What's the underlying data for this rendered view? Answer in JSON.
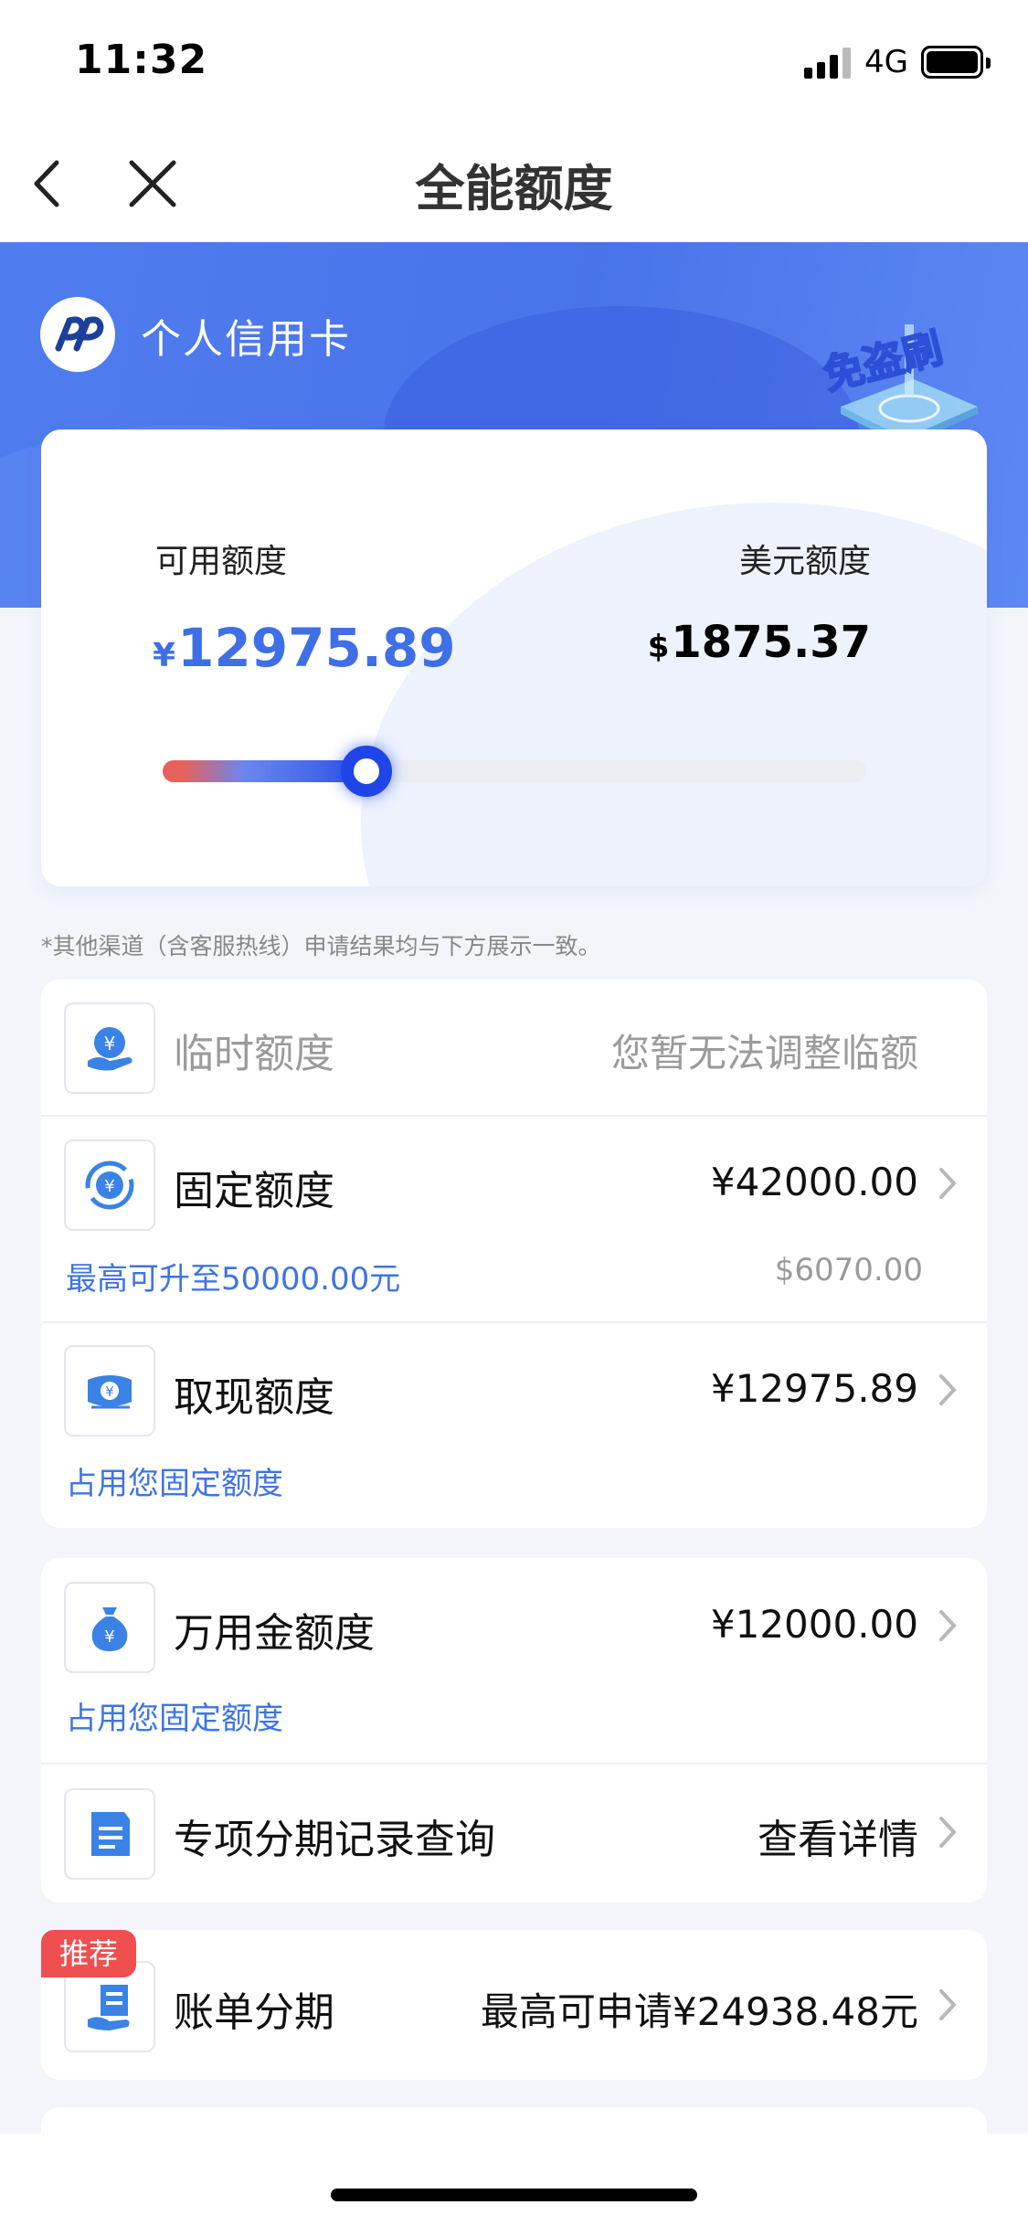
{
  "status_bar": {
    "time": "11:32",
    "network": "4G"
  },
  "nav": {
    "title": "全能额度"
  },
  "hero": {
    "bank_name": "个人信用卡",
    "stamp_text": "免盗刷"
  },
  "card": {
    "available_label": "可用额度",
    "available_currency": "¥",
    "available_amount": "12975.89",
    "usd_label": "美元额度",
    "usd_currency": "$",
    "usd_amount": "1875.37",
    "usage_fraction": 0.29
  },
  "note": "*其他渠道（含客服热线）申请结果均与下方展示一致。",
  "list1": {
    "temp": {
      "title": "临时额度",
      "value": "您暂无法调整临额"
    },
    "fixed": {
      "title": "固定额度",
      "value": "¥42000.00",
      "sub": "最高可升至50000.00元",
      "sub_right": "$6070.00"
    },
    "cash": {
      "title": "取现额度",
      "value": "¥12975.89",
      "sub": "占用您固定额度"
    }
  },
  "list2": {
    "wanyong": {
      "title": "万用金额度",
      "value": "¥12000.00",
      "sub": "占用您固定额度"
    },
    "special": {
      "title": "专项分期记录查询",
      "value": "查看详情"
    }
  },
  "list3": {
    "tag": "推荐",
    "bill": {
      "title": "账单分期",
      "value": "最高可申请¥24938.48元"
    }
  },
  "colors": {
    "accent": "#3f6fe6",
    "hero": "#4f7dee",
    "tag": "#ef4f4f"
  }
}
